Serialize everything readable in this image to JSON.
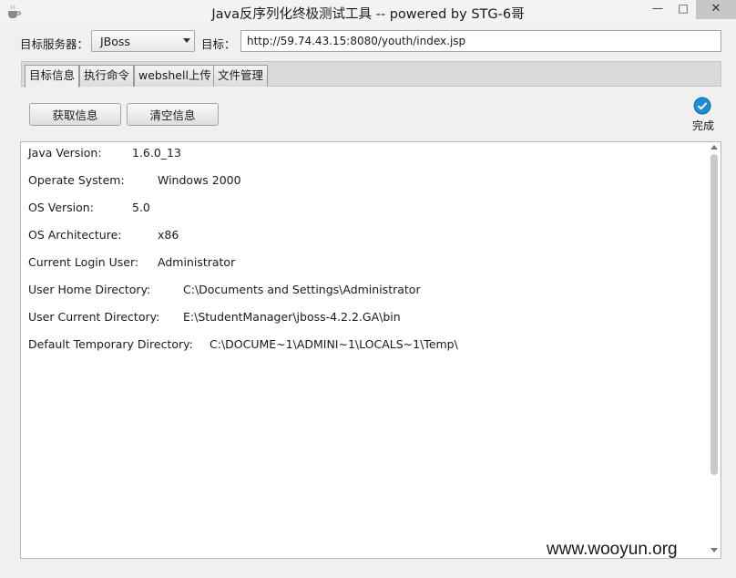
{
  "window": {
    "title": "Java反序列化终极测试工具  -- powered by STG-6哥",
    "minimize_glyph": "—",
    "maximize_glyph": "□",
    "close_glyph": "✕"
  },
  "target": {
    "server_label": "目标服务器：",
    "server_value": "JBoss",
    "url_label": "目标：",
    "url_value": "http://59.74.43.15:8080/youth/index.jsp"
  },
  "tabs": [
    {
      "label": "目标信息",
      "active": true
    },
    {
      "label": "执行命令",
      "active": false
    },
    {
      "label": "webshell上传",
      "active": false
    },
    {
      "label": "文件管理",
      "active": false
    }
  ],
  "actions": {
    "get_info": "获取信息",
    "clear_info": "清空信息"
  },
  "status": {
    "icon": "check-circle-icon",
    "text": "完成",
    "color": "#1b8fd6"
  },
  "output": {
    "rows": [
      {
        "key": "Java Version:",
        "value": "1.6.0_13"
      },
      {
        "key": "Operate System:",
        "value": "Windows 2000"
      },
      {
        "key": "OS Version:",
        "value": "5.0"
      },
      {
        "key": "OS Architecture:",
        "value": "x86"
      },
      {
        "key": "Current Login User:",
        "value": "Administrator"
      },
      {
        "key": "User Home Directory:",
        "value": "C:\\Documents and Settings\\Administrator"
      },
      {
        "key": "User Current Directory:",
        "value": "E:\\StudentManager\\jboss-4.2.2.GA\\bin"
      },
      {
        "key": "Default Temporary Directory:",
        "value": "C:\\DOCUME~1\\ADMINI~1\\LOCALS~1\\Temp\\"
      }
    ]
  },
  "watermark": "www.wooyun.org"
}
